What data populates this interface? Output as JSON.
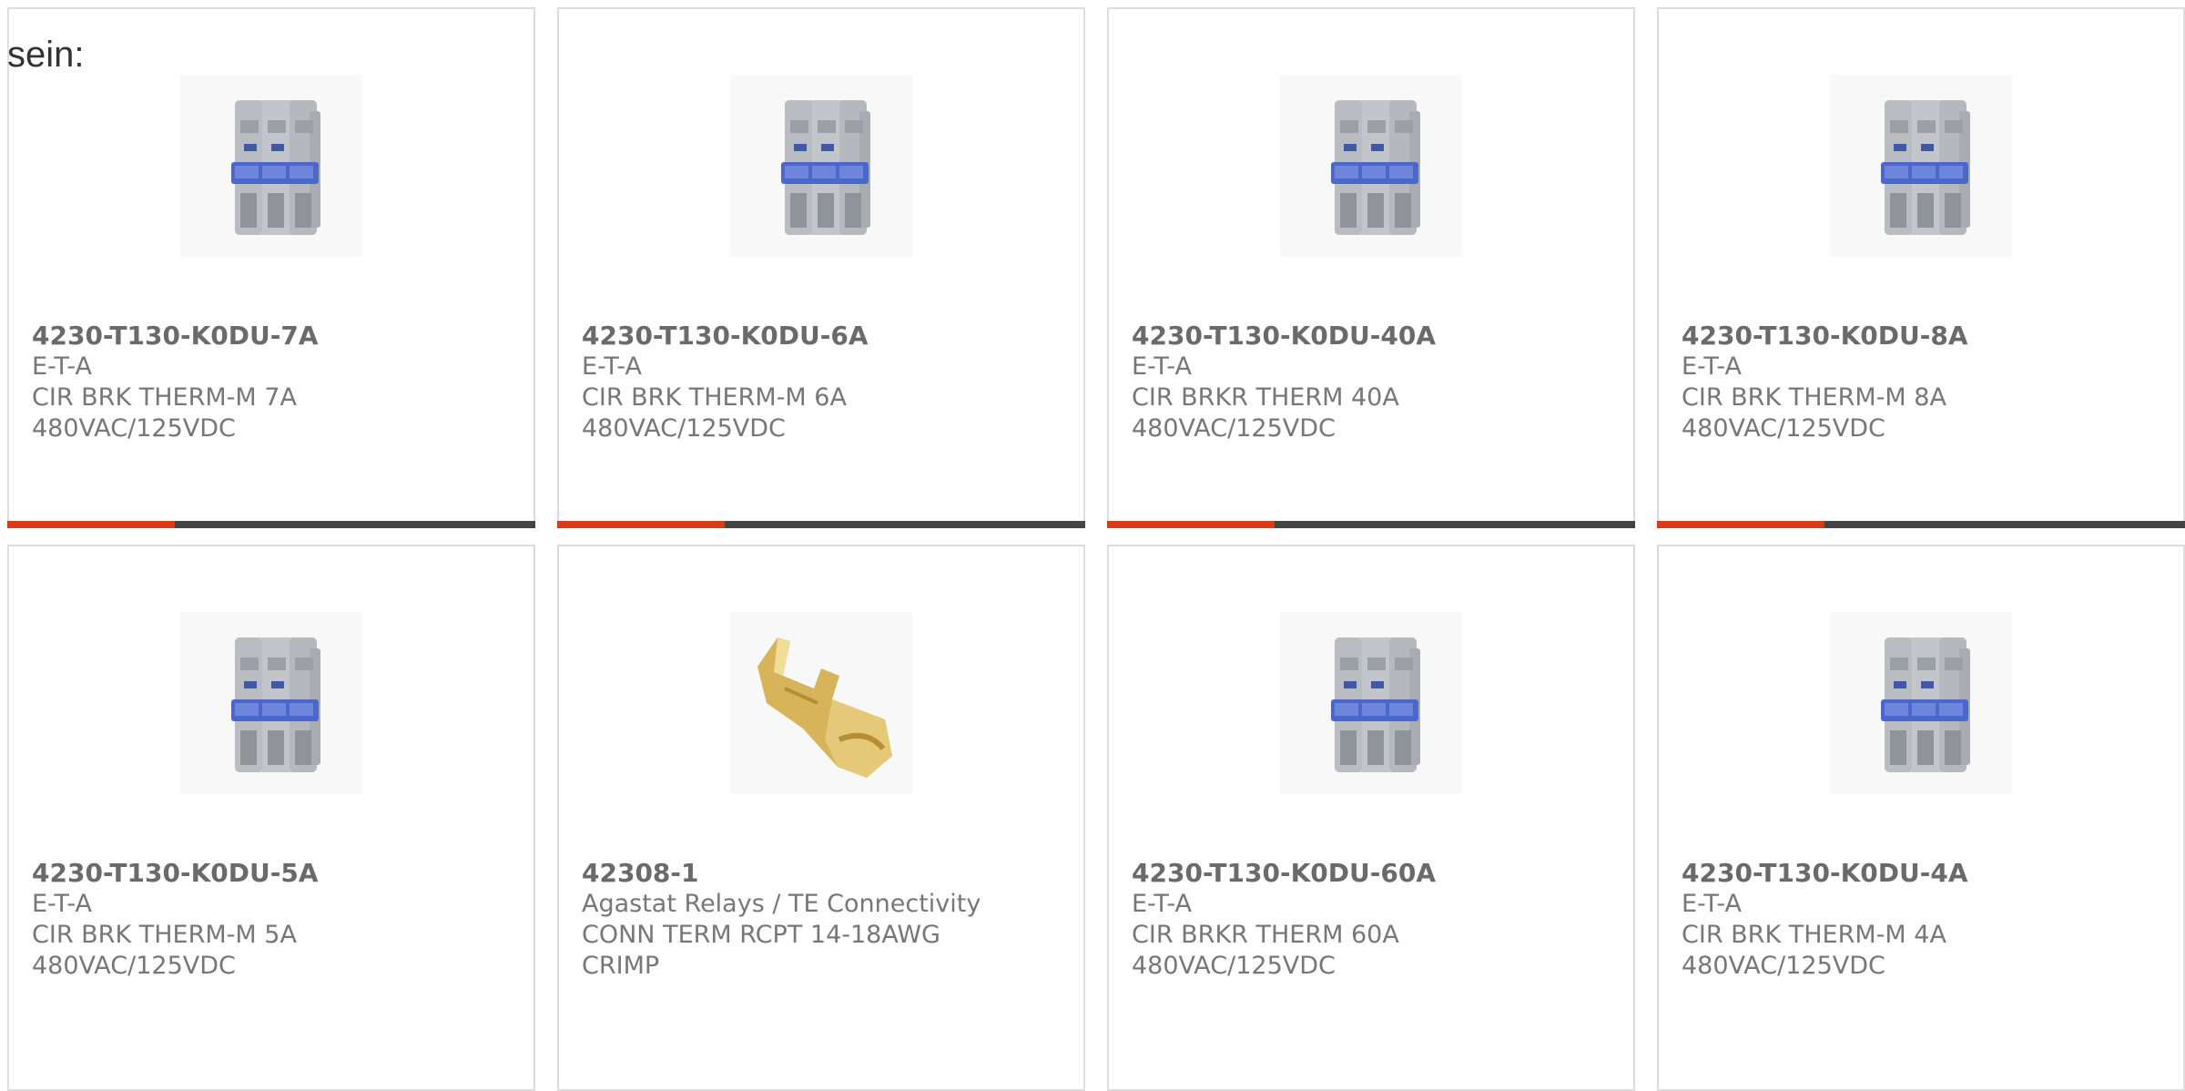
{
  "heading": "sein:",
  "products": [
    {
      "part": "4230-T130-K0DU-7A",
      "brand": "E-T-A",
      "desc1": "CIR BRK THERM-M 7A",
      "desc2": "480VAC/125VDC",
      "image": "circuit-breaker"
    },
    {
      "part": "4230-T130-K0DU-6A",
      "brand": "E-T-A",
      "desc1": "CIR BRK THERM-M 6A",
      "desc2": "480VAC/125VDC",
      "image": "circuit-breaker"
    },
    {
      "part": "4230-T130-K0DU-40A",
      "brand": "E-T-A",
      "desc1": "CIR BRKR THERM 40A",
      "desc2": "480VAC/125VDC",
      "image": "circuit-breaker"
    },
    {
      "part": "4230-T130-K0DU-8A",
      "brand": "E-T-A",
      "desc1": "CIR BRK THERM-M 8A",
      "desc2": "480VAC/125VDC",
      "image": "circuit-breaker"
    },
    {
      "part": "4230-T130-K0DU-5A",
      "brand": "E-T-A",
      "desc1": "CIR BRK THERM-M 5A",
      "desc2": "480VAC/125VDC",
      "image": "circuit-breaker"
    },
    {
      "part": "42308-1",
      "brand": "Agastat Relays / TE Connectivity",
      "desc1": "CONN TERM RCPT 14-18AWG",
      "desc2": "CRIMP",
      "image": "crimp-terminal"
    },
    {
      "part": "4230-T130-K0DU-60A",
      "brand": "E-T-A",
      "desc1": "CIR BRKR THERM 60A",
      "desc2": "480VAC/125VDC",
      "image": "circuit-breaker"
    },
    {
      "part": "4230-T130-K0DU-4A",
      "brand": "E-T-A",
      "desc1": "CIR BRK THERM-M 4A",
      "desc2": "480VAC/125VDC",
      "image": "circuit-breaker"
    }
  ],
  "colors": {
    "accent": "#d93a17",
    "bar": "#444444",
    "border": "#dddddd"
  }
}
